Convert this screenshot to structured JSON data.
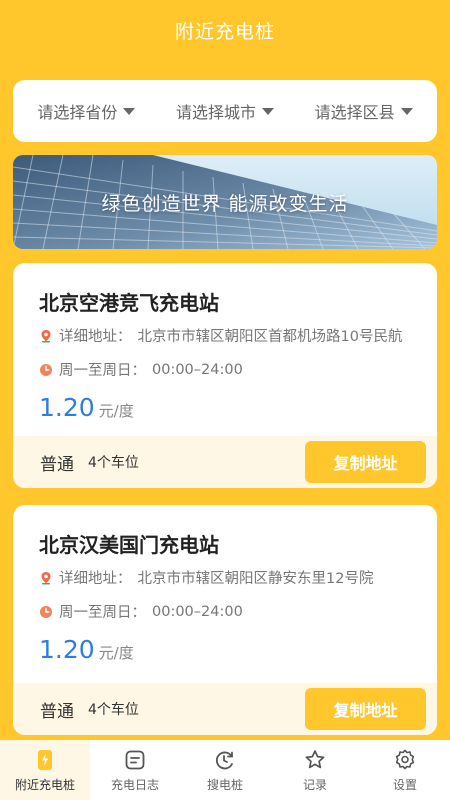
{
  "header": {
    "title": "附近充电桩"
  },
  "filters": [
    {
      "label": "请选择省份"
    },
    {
      "label": "请选择城市"
    },
    {
      "label": "请选择区县"
    }
  ],
  "banner": {
    "text": "绿色创造世界 能源改变生活"
  },
  "stations": [
    {
      "name": "北京空港竞飞充电站",
      "address_label": "详细地址：",
      "address": "北京市市辖区朝阳区首都机场路10号民航",
      "hours_label": "周一至周日：",
      "hours": "00:00–24:00",
      "price": "1.20",
      "price_unit": "元/度",
      "type": "普通",
      "slots": "4个车位",
      "copy_label": "复制地址"
    },
    {
      "name": "北京汉美国门充电站",
      "address_label": "详细地址：",
      "address": "北京市市辖区朝阳区静安东里12号院",
      "hours_label": "周一至周日：",
      "hours": "00:00–24:00",
      "price": "1.20",
      "price_unit": "元/度",
      "type": "普通",
      "slots": "4个车位",
      "copy_label": "复制地址"
    }
  ],
  "tabs": [
    {
      "label": "附近充电桩",
      "icon": "charging-pile-icon",
      "active": true
    },
    {
      "label": "充电日志",
      "icon": "log-icon",
      "active": false
    },
    {
      "label": "搜电桩",
      "icon": "search-pile-icon",
      "active": false
    },
    {
      "label": "记录",
      "icon": "star-icon",
      "active": false
    },
    {
      "label": "设置",
      "icon": "gear-icon",
      "active": false
    }
  ],
  "colors": {
    "primary": "#FFC72C",
    "price": "#2f7de1",
    "footer_bg": "#FFF7E5"
  }
}
